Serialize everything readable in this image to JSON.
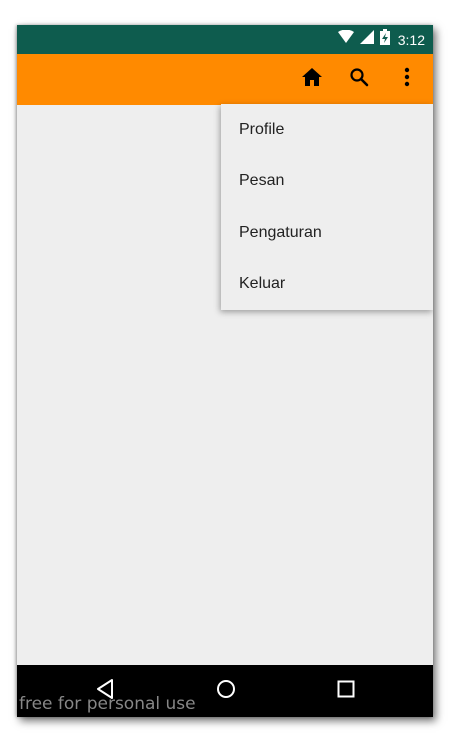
{
  "status_bar": {
    "time": "3:12",
    "icons": [
      "wifi-icon",
      "signal-icon",
      "battery-charging-icon"
    ],
    "color": "#0e5c4e"
  },
  "app_bar": {
    "color": "#ff8a00",
    "actions": [
      "home-icon",
      "search-icon",
      "more-vert-icon"
    ]
  },
  "overflow_menu": {
    "items": [
      {
        "label": "Profile"
      },
      {
        "label": "Pesan"
      },
      {
        "label": "Pengaturan"
      },
      {
        "label": "Keluar"
      }
    ]
  },
  "nav_bar": {
    "buttons": [
      "back-icon",
      "home-circle-icon",
      "recents-icon"
    ]
  },
  "watermark": {
    "text": "free for personal use"
  }
}
